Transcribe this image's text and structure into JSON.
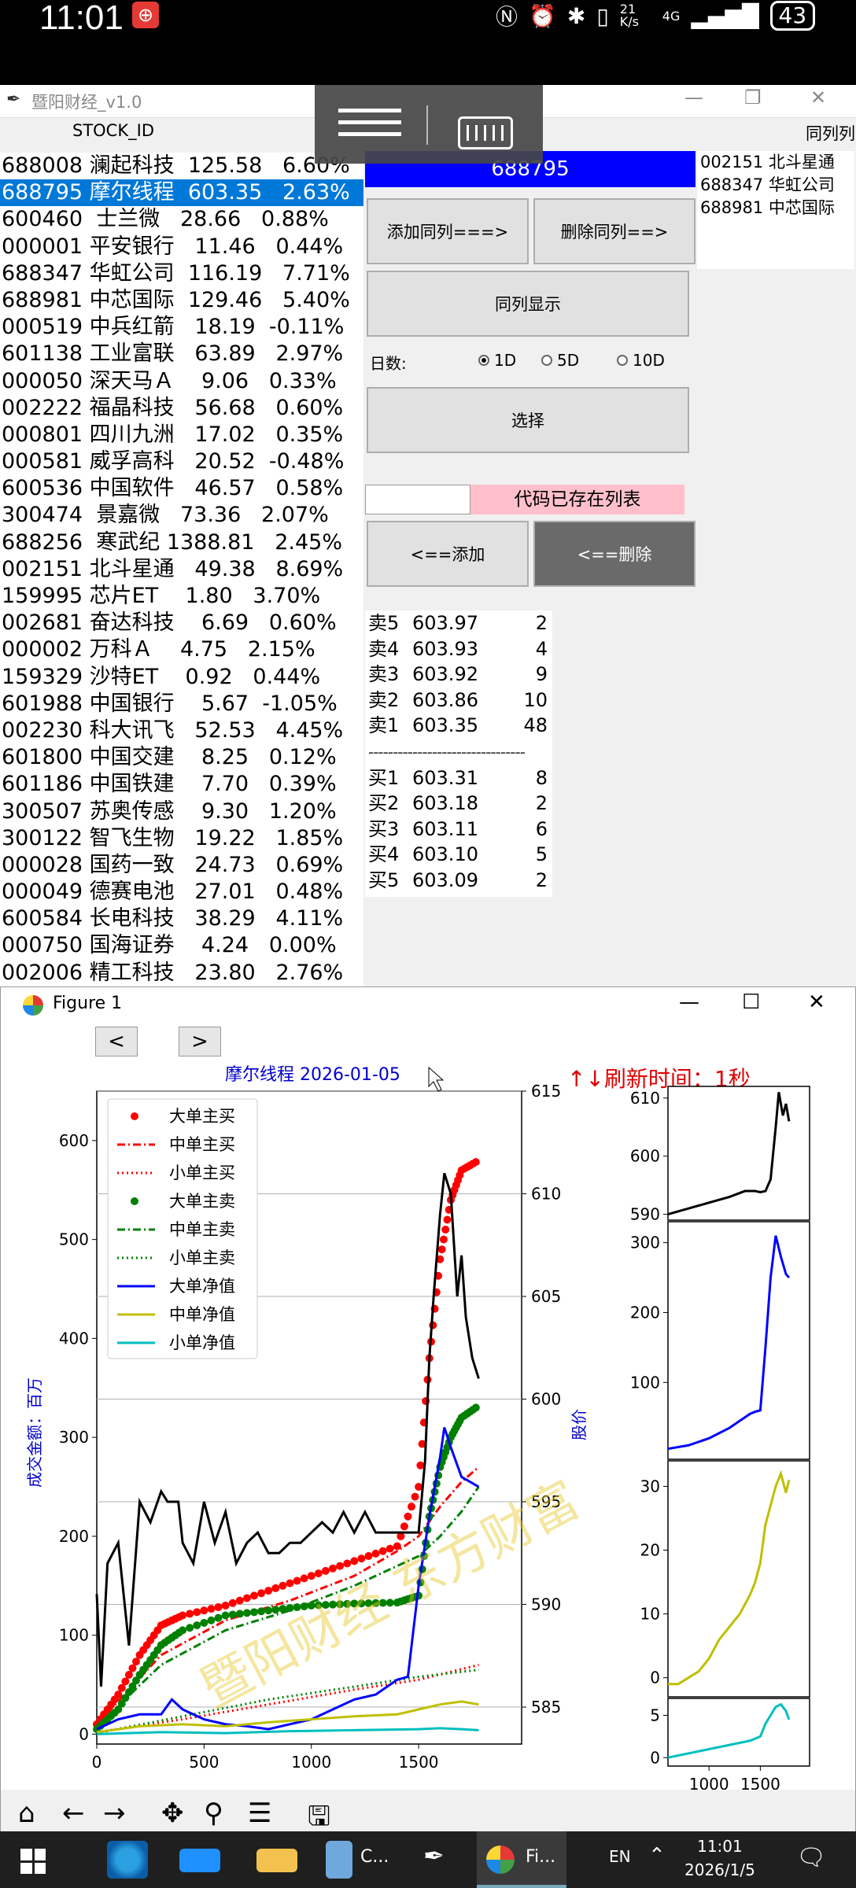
{
  "statusbar": {
    "time": "11:01",
    "battery": "43",
    "net": "21 K/s",
    "signal": "4G"
  },
  "window": {
    "title": "暨阳财经_v1.0",
    "col_stock": "STOCK_ID",
    "col_right": "同列列"
  },
  "stocks": [
    "688008 澜起科技  125.58   6.60%",
    "688795 摩尔线程  603.35   2.63%",
    "600460  士兰微   28.66   0.88%",
    "000001 平安银行   11.46   0.44%",
    "688347 华虹公司  116.19   7.71%",
    "688981 中芯国际  129.46   5.40%",
    "000519 中兵红箭   18.19  -0.11%",
    "601138 工业富联   63.89   2.97%",
    "000050 深天马Ａ    9.06   0.33%",
    "002222 福晶科技   56.68   0.60%",
    "000801 四川九洲   17.02   0.35%",
    "000581 威孚高科   20.52  -0.48%",
    "600536 中国软件   46.57   0.58%",
    "300474  景嘉微   73.36   2.07%",
    "688256  寒武纪 1388.81   2.45%",
    "002151 北斗星通   49.38   8.69%",
    "159995 芯片ET    1.80   3.70%",
    "002681 奋达科技    6.69   0.60%",
    "000002 万科Ａ    4.75   2.15%",
    "159329 沙特ET    0.92   0.44%",
    "601988 中国银行    5.67  -1.05%",
    "002230 科大讯飞   52.53   4.45%",
    "601800 中国交建    8.25   0.12%",
    "601186 中国铁建    7.70   0.39%",
    "300507 苏奥传感    9.30   1.20%",
    "300122 智飞生物   19.22   1.85%",
    "000028 国药一致   24.73   0.69%",
    "000049 德赛电池   27.01   0.48%",
    "600584 长电科技   38.29   4.11%",
    "000750 国海证券    4.24   0.00%",
    "002006 精工科技   23.80   2.76%"
  ],
  "selected_code": "688795",
  "buttons": {
    "add_col": "添加同列===>",
    "del_col": "删除同列==>",
    "show_col": "同列显示",
    "select": "选择",
    "add": "<==添加",
    "delete": "<==删除"
  },
  "days": {
    "label": "日数:",
    "opt1": "1D",
    "opt2": "5D",
    "opt3": "10D"
  },
  "message": "代码已存在列表",
  "tonglie": [
    "002151 北斗星通",
    "688347 华虹公司",
    "688981 中芯国际"
  ],
  "orderbook": {
    "sells": [
      [
        "卖5",
        "603.97",
        "2"
      ],
      [
        "卖4",
        "603.93",
        "4"
      ],
      [
        "卖3",
        "603.92",
        "9"
      ],
      [
        "卖2",
        "603.86",
        "10"
      ],
      [
        "卖1",
        "603.35",
        "48"
      ]
    ],
    "separator": "--------------------------------",
    "buys": [
      [
        "买1",
        "603.31",
        "8"
      ],
      [
        "买2",
        "603.18",
        "2"
      ],
      [
        "买3",
        "603.11",
        "6"
      ],
      [
        "买4",
        "603.10",
        "5"
      ],
      [
        "买5",
        "603.09",
        "2"
      ]
    ]
  },
  "figure": {
    "title": "Figure 1",
    "chart_title": "摩尔线程  2026-01-05",
    "refresh": "↑↓刷新时间：1秒",
    "ylabel_left": "成交金额：百万",
    "ylabel_right": "股价",
    "watermark": "暨阳财经  东方财富"
  },
  "chart_data": [
    {
      "type": "line",
      "title": "摩尔线程  2026-01-05",
      "xlabel": "",
      "ylabel": "成交金额：百万",
      "xlim": [
        0,
        1980
      ],
      "ylim": [
        -10,
        650
      ],
      "xticks": [
        0,
        500,
        1000,
        1500
      ],
      "yticks": [
        0,
        100,
        200,
        300,
        400,
        500,
        600
      ],
      "y2label": "股价",
      "y2lim": [
        583.2,
        615
      ],
      "y2ticks": [
        585,
        590,
        595,
        600,
        605,
        610,
        615
      ],
      "legend": [
        "大单主买",
        "中单主买",
        "小单主买",
        "大单主卖",
        "中单主卖",
        "小单主卖",
        "大单净值",
        "中单净值",
        "小单净值"
      ],
      "legend_position": "upper-left",
      "series": [
        {
          "name": "大单主买",
          "style": "dots",
          "color": "#ff0000",
          "x": [
            0,
            100,
            200,
            300,
            400,
            600,
            800,
            1000,
            1200,
            1400,
            1500,
            1550,
            1600,
            1650,
            1700,
            1780
          ],
          "values": [
            10,
            40,
            80,
            110,
            120,
            130,
            145,
            160,
            175,
            190,
            250,
            380,
            480,
            540,
            570,
            580
          ]
        },
        {
          "name": "中单主买",
          "style": "dashdot",
          "color": "#ff0000",
          "x": [
            0,
            300,
            600,
            900,
            1200,
            1400,
            1500,
            1600,
            1700,
            1780
          ],
          "values": [
            10,
            80,
            115,
            135,
            160,
            185,
            200,
            230,
            255,
            270
          ]
        },
        {
          "name": "小单主买",
          "style": "dotted",
          "color": "#ff0000",
          "x": [
            0,
            400,
            800,
            1200,
            1500,
            1780
          ],
          "values": [
            2,
            15,
            30,
            45,
            55,
            70
          ]
        },
        {
          "name": "大单主卖",
          "style": "dots",
          "color": "#008000",
          "x": [
            0,
            100,
            200,
            300,
            400,
            600,
            800,
            1000,
            1200,
            1400,
            1500,
            1550,
            1600,
            1650,
            1700,
            1780
          ],
          "values": [
            5,
            25,
            60,
            90,
            105,
            120,
            125,
            130,
            132,
            133,
            140,
            220,
            270,
            300,
            320,
            332
          ]
        },
        {
          "name": "中单主卖",
          "style": "dashdot",
          "color": "#008000",
          "x": [
            0,
            300,
            600,
            900,
            1200,
            1400,
            1500,
            1600,
            1700,
            1780
          ],
          "values": [
            8,
            70,
            105,
            125,
            150,
            170,
            180,
            200,
            225,
            250
          ]
        },
        {
          "name": "小单主卖",
          "style": "dotted",
          "color": "#008000",
          "x": [
            0,
            400,
            800,
            1200,
            1500,
            1780
          ],
          "values": [
            1,
            18,
            35,
            48,
            58,
            65
          ]
        },
        {
          "name": "大单净值",
          "style": "solid",
          "color": "#0000ff",
          "x": [
            0,
            100,
            200,
            300,
            350,
            400,
            500,
            600,
            700,
            800,
            900,
            1000,
            1100,
            1200,
            1300,
            1400,
            1450,
            1500,
            1550,
            1600,
            1620,
            1650,
            1700,
            1780
          ],
          "values": [
            5,
            15,
            20,
            20,
            35,
            25,
            15,
            10,
            8,
            5,
            10,
            15,
            25,
            35,
            40,
            55,
            58,
            150,
            220,
            280,
            310,
            290,
            260,
            250
          ]
        },
        {
          "name": "中单净值",
          "style": "solid",
          "color": "#bfbf00",
          "x": [
            0,
            200,
            400,
            600,
            800,
            1000,
            1200,
            1400,
            1500,
            1600,
            1700,
            1780
          ],
          "values": [
            2,
            8,
            10,
            8,
            12,
            15,
            18,
            20,
            25,
            30,
            33,
            30
          ]
        },
        {
          "name": "小单净值",
          "style": "solid",
          "color": "#00bfbf",
          "x": [
            0,
            300,
            600,
            900,
            1200,
            1500,
            1600,
            1700,
            1780
          ],
          "values": [
            0,
            2,
            1,
            3,
            4,
            5,
            6,
            5,
            4
          ]
        },
        {
          "name": "股价",
          "axis": "right",
          "style": "solid",
          "color": "#000000",
          "x": [
            0,
            20,
            50,
            100,
            150,
            200,
            250,
            300,
            330,
            380,
            400,
            450,
            500,
            550,
            600,
            650,
            700,
            750,
            800,
            850,
            900,
            950,
            1000,
            1050,
            1100,
            1150,
            1200,
            1250,
            1300,
            1350,
            1400,
            1450,
            1500,
            1530,
            1550,
            1570,
            1600,
            1620,
            1650,
            1680,
            1700,
            1720,
            1750,
            1780
          ],
          "values": [
            590.5,
            586,
            592,
            593,
            588,
            595,
            594,
            595.5,
            595,
            595,
            593,
            592,
            595,
            593,
            594.5,
            592,
            593,
            593.5,
            592.5,
            592.5,
            593,
            593,
            593.5,
            594,
            593.5,
            594.5,
            593.5,
            594.5,
            593.5,
            593.5,
            593.5,
            593.5,
            593.5,
            597,
            602,
            605,
            609,
            611,
            610,
            605,
            607,
            604,
            602,
            601
          ]
        }
      ]
    },
    {
      "type": "line",
      "xlim": [
        600,
        1980
      ],
      "ylim": [
        589,
        612
      ],
      "xticks": [
        1000,
        1500
      ],
      "yticks": [
        590,
        600,
        610
      ],
      "series": [
        {
          "name": "股价",
          "color": "#000000",
          "x": [
            600,
            800,
            1000,
            1200,
            1350,
            1450,
            1500,
            1550,
            1600,
            1650,
            1680,
            1720,
            1750,
            1780
          ],
          "values": [
            590,
            591,
            592,
            593,
            594,
            594,
            593.8,
            594,
            596,
            605,
            611,
            607,
            609,
            606
          ]
        }
      ]
    },
    {
      "type": "line",
      "xlim": [
        600,
        1980
      ],
      "ylim": [
        -10,
        330
      ],
      "xticks": [
        1000,
        1500
      ],
      "yticks": [
        100,
        200,
        300
      ],
      "series": [
        {
          "name": "大单净值",
          "color": "#0000ff",
          "x": [
            600,
            800,
            1000,
            1200,
            1300,
            1400,
            1450,
            1500,
            1550,
            1600,
            1650,
            1700,
            1750,
            1780
          ],
          "values": [
            5,
            10,
            20,
            35,
            45,
            55,
            58,
            60,
            150,
            250,
            310,
            280,
            255,
            250
          ]
        }
      ]
    },
    {
      "type": "line",
      "xlim": [
        600,
        1980
      ],
      "ylim": [
        -3,
        34
      ],
      "xticks": [
        1000,
        1500
      ],
      "yticks": [
        0,
        10,
        20,
        30
      ],
      "series": [
        {
          "name": "中单净值",
          "color": "#bfbf00",
          "x": [
            600,
            700,
            800,
            900,
            1000,
            1100,
            1200,
            1300,
            1400,
            1450,
            1500,
            1550,
            1600,
            1650,
            1700,
            1750,
            1780
          ],
          "values": [
            -1,
            -1,
            0,
            1,
            3,
            6,
            8,
            10,
            13,
            15,
            18,
            24,
            27,
            30,
            32,
            29,
            31
          ]
        }
      ]
    },
    {
      "type": "line",
      "xlim": [
        600,
        1980
      ],
      "ylim": [
        -1,
        7
      ],
      "xticks": [
        1000,
        1500
      ],
      "yticks": [
        0,
        5
      ],
      "series": [
        {
          "name": "小单净值",
          "color": "#00bfbf",
          "x": [
            600,
            800,
            1000,
            1200,
            1400,
            1500,
            1550,
            1600,
            1650,
            1700,
            1750,
            1780
          ],
          "values": [
            0,
            0.5,
            1,
            1.5,
            2,
            2.5,
            4,
            5,
            6,
            6.3,
            5.5,
            4.5
          ]
        }
      ]
    }
  ],
  "taskbar": {
    "time": "11:01",
    "date": "2026/1/5",
    "lang": "EN",
    "app1": "C...",
    "app2": "Fi..."
  }
}
